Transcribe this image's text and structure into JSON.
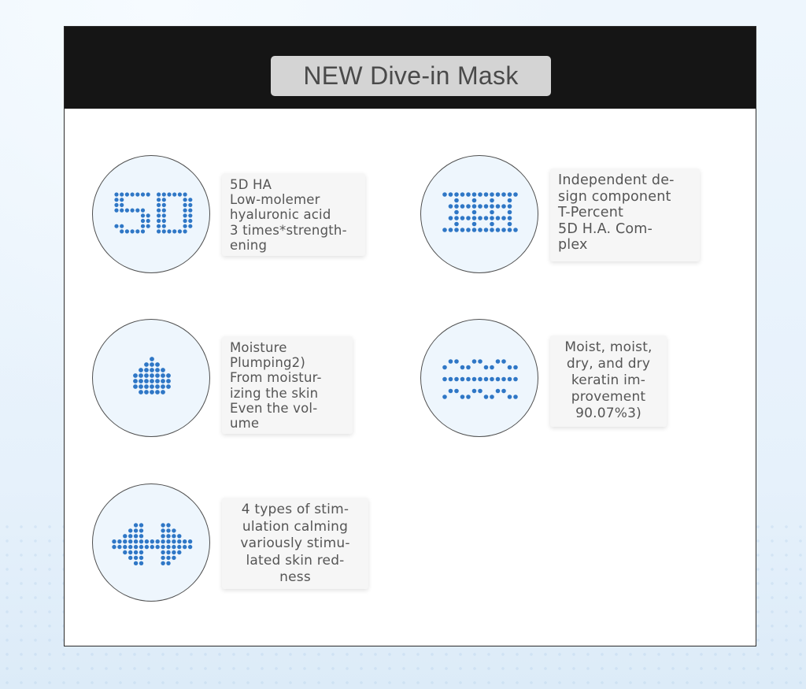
{
  "title": "NEW Dive-in Mask",
  "colors": {
    "dot": "#2f77c6",
    "header": "#151515",
    "circle_fill": "#eef6fd",
    "card_fill": "#f6f6f6",
    "text": "#555555"
  },
  "features": [
    {
      "icon": "5d-dot-icon",
      "lines": [
        "5D HA",
        "Low-molemer",
        "hyaluronic acid",
        "3 times*strength-",
        "ening"
      ]
    },
    {
      "icon": "stacked-layers-dot-icon",
      "lines": [
        "Independent de-",
        "sign component",
        "T-Percent",
        "5D H.A. Com-",
        "plex"
      ]
    },
    {
      "icon": "water-drop-dot-icon",
      "lines": [
        "Moisture",
        "Plumping2)",
        "From moistur-",
        "izing the skin",
        "Even the vol-",
        "ume"
      ]
    },
    {
      "icon": "wavy-layers-dot-icon",
      "lines": [
        "Moist, moist,",
        "dry, and dry",
        "keratin im-",
        "provement",
        "90.07%3)"
      ]
    },
    {
      "icon": "calming-arrows-dot-icon",
      "lines": [
        "4 types of stim-",
        "ulation calming",
        "variously stimu-",
        "lated skin red-",
        "ness"
      ]
    }
  ]
}
